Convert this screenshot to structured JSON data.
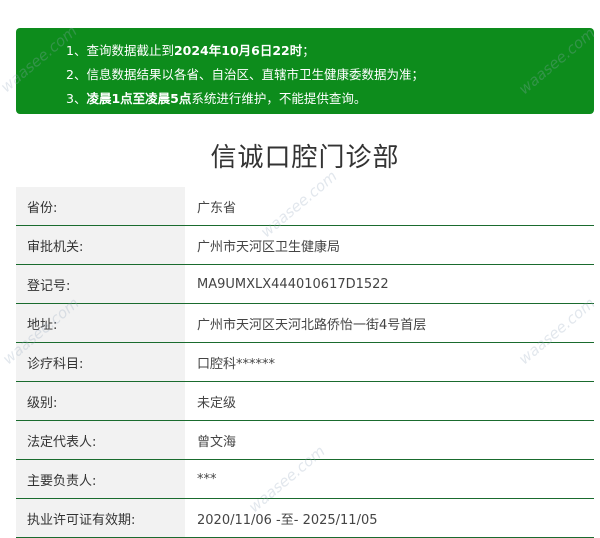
{
  "notice": {
    "lines": [
      {
        "prefix": "1、",
        "pre": "查询数据截止到",
        "bold": "2024年10月6日22时",
        "post": "；"
      },
      {
        "prefix": "2、",
        "pre": "信息数据结果以各省、自治区、直辖市卫生健康委数据为准；",
        "bold": "",
        "post": ""
      },
      {
        "prefix": "3、",
        "pre": "",
        "bold": "凌晨1点至凌晨5点",
        "post": "系统进行维护，不能提供查询。"
      }
    ]
  },
  "title": "信诚口腔门诊部",
  "rows": [
    {
      "label": "省份:",
      "value": "广东省"
    },
    {
      "label": "审批机关:",
      "value": "广州市天河区卫生健康局"
    },
    {
      "label": "登记号:",
      "value": "MA9UMXLX444010617D1522"
    },
    {
      "label": "地址:",
      "value": "广州市天河区天河北路侨怡一街4号首层"
    },
    {
      "label": "诊疗科目:",
      "value": "口腔科******"
    },
    {
      "label": "级别:",
      "value": "未定级"
    },
    {
      "label": "法定代表人:",
      "value": "曾文海"
    },
    {
      "label": "主要负责人:",
      "value": "***"
    },
    {
      "label": "执业许可证有效期:",
      "value": "2020/11/06 -至- 2025/11/05"
    }
  ],
  "watermark": "waasee.com",
  "colors": {
    "notice_bg": "#0d8c1c",
    "row_border": "#1a6b2e",
    "label_bg": "#f2f2f2"
  }
}
